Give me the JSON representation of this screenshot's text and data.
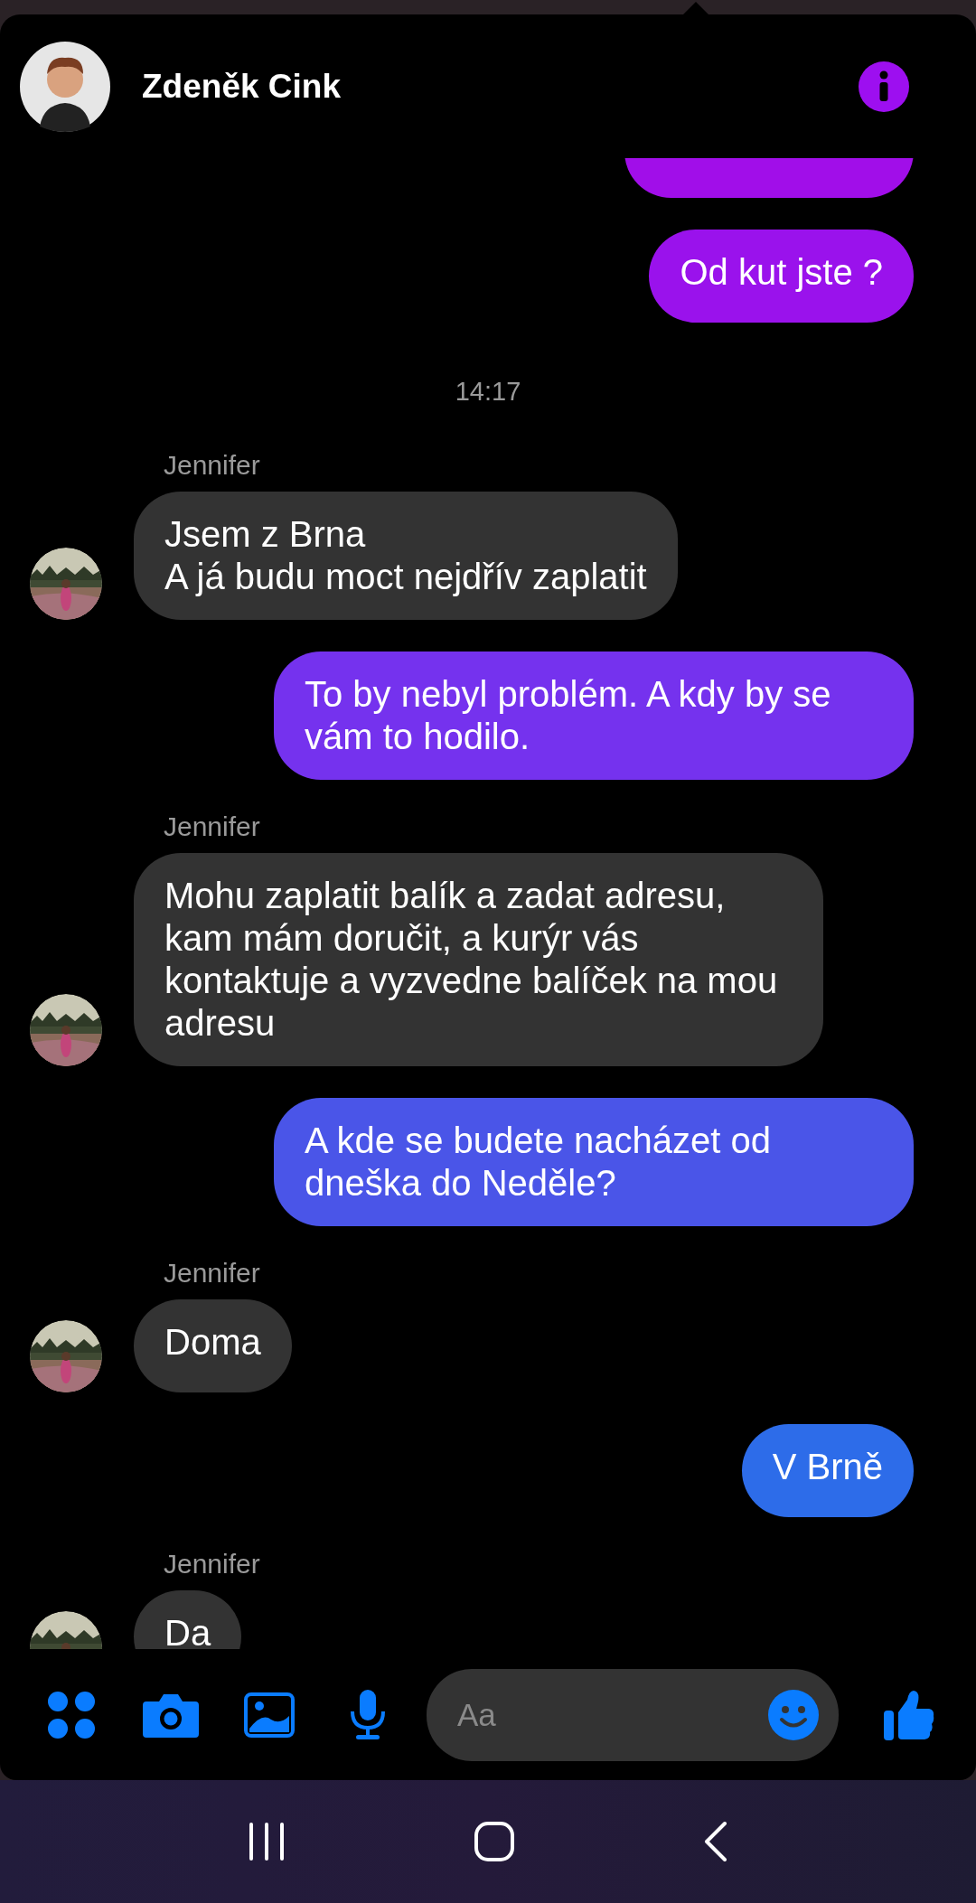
{
  "header": {
    "name": "Zdeněk Cink"
  },
  "messages": [
    {
      "kind": "outgoing",
      "color": "#a10ee9"
    },
    {
      "kind": "outgoing",
      "text": "Od kut jste ?",
      "color": "#9a12ec"
    },
    {
      "kind": "time",
      "text": "14:17"
    },
    {
      "kind": "incoming",
      "sender": "Jennifer",
      "text": "Jsem z Brna\nA já budu moct nejdřív zaplatit"
    },
    {
      "kind": "outgoing",
      "text": "To by nebyl problém. A kdy by se vám to hodilo.",
      "color": "#7532ee"
    },
    {
      "kind": "incoming",
      "sender": "Jennifer",
      "text": "Mohu zaplatit balík a zadat adresu, kam mám doručit, a kurýr vás kontaktuje a vyzvedne balíček na mou adresu"
    },
    {
      "kind": "outgoing",
      "text": "A kde se budete nacházet od dneška do Neděle?",
      "color": "#4a55e8"
    },
    {
      "kind": "incoming",
      "sender": "Jennifer",
      "text": "Doma"
    },
    {
      "kind": "outgoing",
      "text": "V Brně",
      "color": "#2d6ce9"
    },
    {
      "kind": "incoming",
      "sender": "Jennifer",
      "text": "Da"
    }
  ],
  "composer": {
    "placeholder": "Aa"
  }
}
